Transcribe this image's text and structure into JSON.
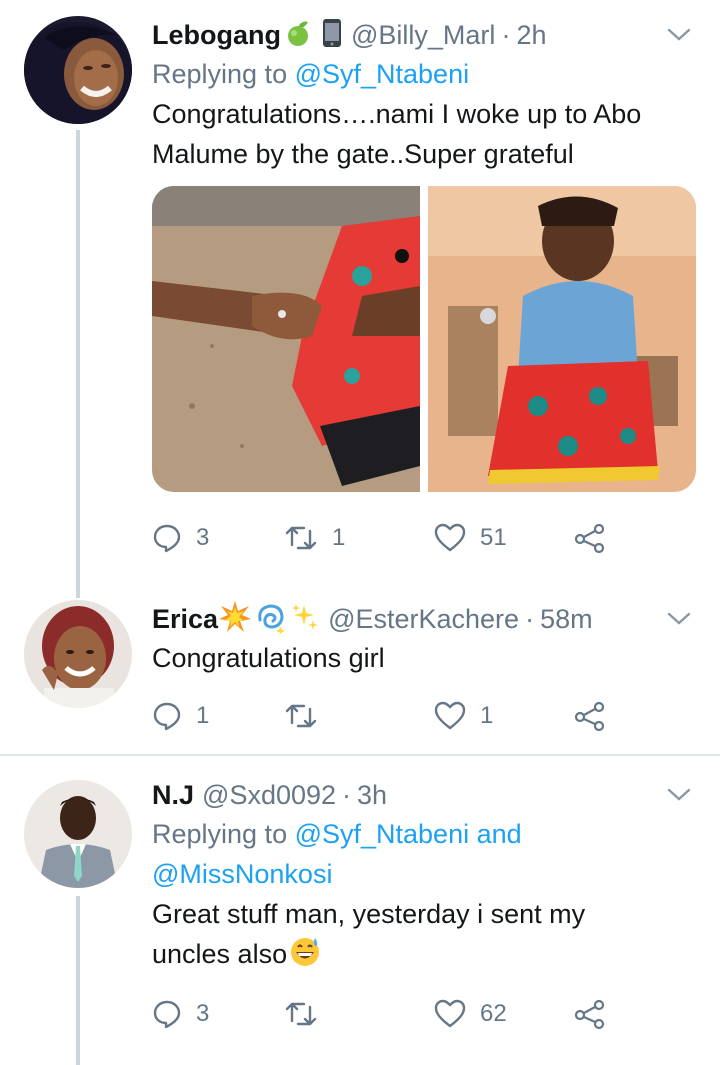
{
  "tweets": [
    {
      "name": "Lebogang",
      "name_emojis": [
        "green-apple-emoji",
        "mobile-phone-emoji"
      ],
      "handle": "@Billy_Marl",
      "time": "2h",
      "replying_prefix": "Replying to ",
      "replying_to": "@Syf_Ntabeni",
      "text_lines": [
        "Congratulations….nami I woke up to Abo",
        "Malume by the gate..Super grateful"
      ],
      "media": [
        "photo-hands-ring",
        "photo-seated-woman"
      ],
      "reply_count": "3",
      "retweet_count": "1",
      "like_count": "51"
    },
    {
      "name": "Erica",
      "name_emojis": [
        "collision-emoji",
        "dizzy-emoji",
        "sparkles-emoji"
      ],
      "handle": "@EsterKachere",
      "time": "58m",
      "text_lines": [
        "Congratulations girl"
      ],
      "reply_count": "1",
      "retweet_count": "",
      "like_count": "1"
    },
    {
      "name": "N.J",
      "handle": "@Sxd0092",
      "time": "3h",
      "replying_prefix": "Replying to ",
      "replying_to": "@Syf_Ntabeni and",
      "replying_to_2": "@MissNonkosi",
      "text_lines": [
        "Great stuff man, yesterday i sent my",
        "uncles also"
      ],
      "text_emoji": "grinning-sweat-emoji",
      "reply_count": "3",
      "retweet_count": "",
      "like_count": "62"
    }
  ],
  "separator": "·",
  "colors": {
    "text": "#14171a",
    "secondary": "#657786",
    "link": "#1da1f2",
    "thread_line": "#ccd6dd",
    "divider": "#e1e8ed"
  }
}
